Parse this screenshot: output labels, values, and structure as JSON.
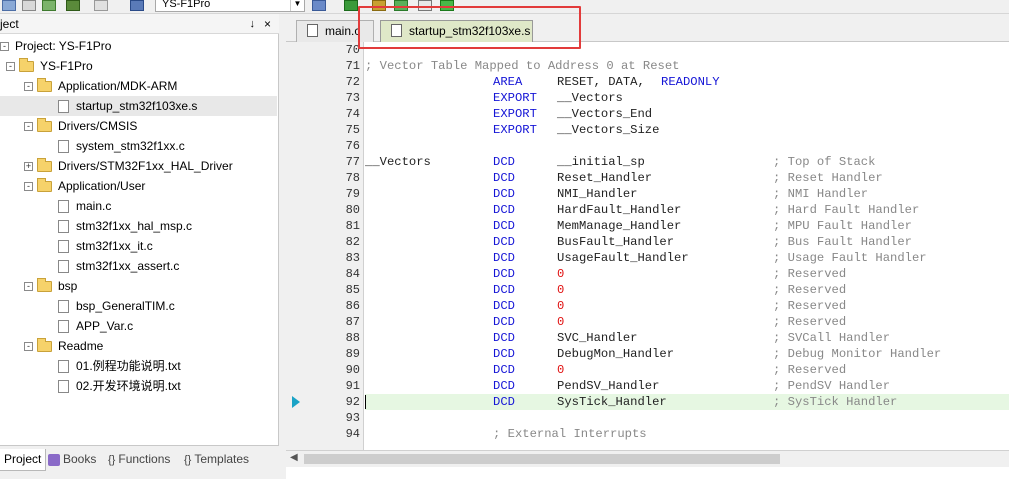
{
  "toolbar": {
    "target": "YS-F1Pro",
    "icons": [
      "save-all-icon",
      "options-icon",
      "stack-icon",
      "translate-icon",
      "rebuild-icon",
      "target-options-icon",
      "debug-icon",
      "download-icon",
      "manage-icon",
      "pack-icon"
    ]
  },
  "project_panel": {
    "title": "ject",
    "pin": "↓",
    "close": "×",
    "tree": [
      {
        "label": "Project: YS-F1Pro",
        "level": 0,
        "type": "project",
        "expand": "-"
      },
      {
        "label": "YS-F1Pro",
        "level": 1,
        "type": "group-root",
        "expand": "-"
      },
      {
        "label": "Application/MDK-ARM",
        "level": 2,
        "type": "folder",
        "expand": "-"
      },
      {
        "label": "startup_stm32f103xe.s",
        "level": 3,
        "type": "file",
        "selected": true
      },
      {
        "label": "Drivers/CMSIS",
        "level": 2,
        "type": "folder",
        "expand": "-"
      },
      {
        "label": "system_stm32f1xx.c",
        "level": 3,
        "type": "file"
      },
      {
        "label": "Drivers/STM32F1xx_HAL_Driver",
        "level": 2,
        "type": "folder",
        "expand": "+"
      },
      {
        "label": "Application/User",
        "level": 2,
        "type": "folder",
        "expand": "-"
      },
      {
        "label": "main.c",
        "level": 3,
        "type": "file"
      },
      {
        "label": "stm32f1xx_hal_msp.c",
        "level": 3,
        "type": "file"
      },
      {
        "label": "stm32f1xx_it.c",
        "level": 3,
        "type": "file"
      },
      {
        "label": "stm32f1xx_assert.c",
        "level": 3,
        "type": "file"
      },
      {
        "label": "bsp",
        "level": 2,
        "type": "folder",
        "expand": "-"
      },
      {
        "label": "bsp_GeneralTIM.c",
        "level": 3,
        "type": "file"
      },
      {
        "label": "APP_Var.c",
        "level": 3,
        "type": "file"
      },
      {
        "label": "Readme",
        "level": 2,
        "type": "folder",
        "expand": "-"
      },
      {
        "label": "01.例程功能说明.txt",
        "level": 3,
        "type": "file"
      },
      {
        "label": "02.开发环境说明.txt",
        "level": 3,
        "type": "file"
      }
    ],
    "tabs": [
      {
        "label": "Project",
        "active": true,
        "icon": ""
      },
      {
        "label": "Books",
        "active": false,
        "icon": "books-icon"
      },
      {
        "label": "Functions",
        "active": false,
        "icon": "{}"
      },
      {
        "label": "Templates",
        "active": false,
        "icon": "{}"
      }
    ]
  },
  "editor": {
    "tabs": [
      {
        "label": "main.c",
        "active": false
      },
      {
        "label": "startup_stm32f103xe.s",
        "active": true
      }
    ],
    "current_line": 92,
    "lines": [
      {
        "n": 70,
        "segs": []
      },
      {
        "n": 71,
        "segs": [
          {
            "t": "; Vector Table Mapped to Address 0 at Reset",
            "c": "cm",
            "col": 0
          }
        ]
      },
      {
        "n": 72,
        "segs": [
          {
            "t": "AREA",
            "c": "kw",
            "col": 16
          },
          {
            "t": "RESET, DATA,",
            "c": "id",
            "col": 24
          },
          {
            "t": "READONLY",
            "c": "kw",
            "col": 37
          }
        ]
      },
      {
        "n": 73,
        "segs": [
          {
            "t": "EXPORT",
            "c": "kw",
            "col": 16
          },
          {
            "t": "__Vectors",
            "c": "id",
            "col": 24
          }
        ]
      },
      {
        "n": 74,
        "segs": [
          {
            "t": "EXPORT",
            "c": "kw",
            "col": 16
          },
          {
            "t": "__Vectors_End",
            "c": "id",
            "col": 24
          }
        ]
      },
      {
        "n": 75,
        "segs": [
          {
            "t": "EXPORT",
            "c": "kw",
            "col": 16
          },
          {
            "t": "__Vectors_Size",
            "c": "id",
            "col": 24
          }
        ]
      },
      {
        "n": 76,
        "segs": []
      },
      {
        "n": 77,
        "segs": [
          {
            "t": "__Vectors",
            "c": "id",
            "col": 0
          },
          {
            "t": "DCD",
            "c": "kw",
            "col": 16
          },
          {
            "t": "__initial_sp",
            "c": "id",
            "col": 24
          },
          {
            "t": "; Top of Stack",
            "c": "cm",
            "col": 51
          }
        ]
      },
      {
        "n": 78,
        "segs": [
          {
            "t": "DCD",
            "c": "kw",
            "col": 16
          },
          {
            "t": "Reset_Handler",
            "c": "id",
            "col": 24
          },
          {
            "t": "; Reset Handler",
            "c": "cm",
            "col": 51
          }
        ]
      },
      {
        "n": 79,
        "segs": [
          {
            "t": "DCD",
            "c": "kw",
            "col": 16
          },
          {
            "t": "NMI_Handler",
            "c": "id",
            "col": 24
          },
          {
            "t": "; NMI Handler",
            "c": "cm",
            "col": 51
          }
        ]
      },
      {
        "n": 80,
        "segs": [
          {
            "t": "DCD",
            "c": "kw",
            "col": 16
          },
          {
            "t": "HardFault_Handler",
            "c": "id",
            "col": 24
          },
          {
            "t": "; Hard Fault Handler",
            "c": "cm",
            "col": 51
          }
        ]
      },
      {
        "n": 81,
        "segs": [
          {
            "t": "DCD",
            "c": "kw",
            "col": 16
          },
          {
            "t": "MemManage_Handler",
            "c": "id",
            "col": 24
          },
          {
            "t": "; MPU Fault Handler",
            "c": "cm",
            "col": 51
          }
        ]
      },
      {
        "n": 82,
        "segs": [
          {
            "t": "DCD",
            "c": "kw",
            "col": 16
          },
          {
            "t": "BusFault_Handler",
            "c": "id",
            "col": 24
          },
          {
            "t": "; Bus Fault Handler",
            "c": "cm",
            "col": 51
          }
        ]
      },
      {
        "n": 83,
        "segs": [
          {
            "t": "DCD",
            "c": "kw",
            "col": 16
          },
          {
            "t": "UsageFault_Handler",
            "c": "id",
            "col": 24
          },
          {
            "t": "; Usage Fault Handler",
            "c": "cm",
            "col": 51
          }
        ]
      },
      {
        "n": 84,
        "segs": [
          {
            "t": "DCD",
            "c": "kw",
            "col": 16
          },
          {
            "t": "0",
            "c": "num",
            "col": 24
          },
          {
            "t": "; Reserved",
            "c": "cm",
            "col": 51
          }
        ]
      },
      {
        "n": 85,
        "segs": [
          {
            "t": "DCD",
            "c": "kw",
            "col": 16
          },
          {
            "t": "0",
            "c": "num",
            "col": 24
          },
          {
            "t": "; Reserved",
            "c": "cm",
            "col": 51
          }
        ]
      },
      {
        "n": 86,
        "segs": [
          {
            "t": "DCD",
            "c": "kw",
            "col": 16
          },
          {
            "t": "0",
            "c": "num",
            "col": 24
          },
          {
            "t": "; Reserved",
            "c": "cm",
            "col": 51
          }
        ]
      },
      {
        "n": 87,
        "segs": [
          {
            "t": "DCD",
            "c": "kw",
            "col": 16
          },
          {
            "t": "0",
            "c": "num",
            "col": 24
          },
          {
            "t": "; Reserved",
            "c": "cm",
            "col": 51
          }
        ]
      },
      {
        "n": 88,
        "segs": [
          {
            "t": "DCD",
            "c": "kw",
            "col": 16
          },
          {
            "t": "SVC_Handler",
            "c": "id",
            "col": 24
          },
          {
            "t": "; SVCall Handler",
            "c": "cm",
            "col": 51
          }
        ]
      },
      {
        "n": 89,
        "segs": [
          {
            "t": "DCD",
            "c": "kw",
            "col": 16
          },
          {
            "t": "DebugMon_Handler",
            "c": "id",
            "col": 24
          },
          {
            "t": "; Debug Monitor Handler",
            "c": "cm",
            "col": 51
          }
        ]
      },
      {
        "n": 90,
        "segs": [
          {
            "t": "DCD",
            "c": "kw",
            "col": 16
          },
          {
            "t": "0",
            "c": "num",
            "col": 24
          },
          {
            "t": "; Reserved",
            "c": "cm",
            "col": 51
          }
        ]
      },
      {
        "n": 91,
        "segs": [
          {
            "t": "DCD",
            "c": "kw",
            "col": 16
          },
          {
            "t": "PendSV_Handler",
            "c": "id",
            "col": 24
          },
          {
            "t": "; PendSV Handler",
            "c": "cm",
            "col": 51
          }
        ]
      },
      {
        "n": 92,
        "segs": [
          {
            "t": "DCD",
            "c": "kw",
            "col": 16
          },
          {
            "t": "SysTick_Handler",
            "c": "id",
            "col": 24
          },
          {
            "t": "; SysTick Handler",
            "c": "cm",
            "col": 51
          }
        ]
      },
      {
        "n": 93,
        "segs": []
      },
      {
        "n": 94,
        "segs": [
          {
            "t": "; External Interrupts",
            "c": "cm",
            "col": 16
          }
        ]
      }
    ]
  },
  "colors": {
    "keyword": "#1515d6",
    "comment": "#888888",
    "number": "#e01010",
    "current_line": "#e6f7e2",
    "highlight_box": "#e23b3b",
    "active_tab": "#dfe8c8"
  }
}
